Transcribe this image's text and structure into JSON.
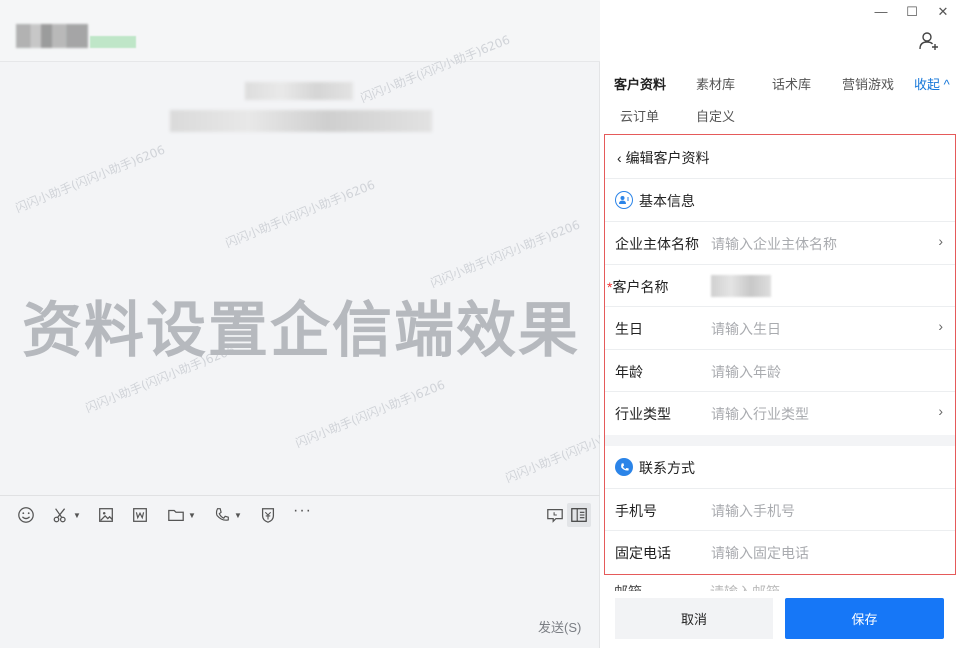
{
  "watermark_text": "闪闪小助手(闪闪小助手)6206",
  "overlay_title": "资料设置企信端效果",
  "composer": {
    "send_label": "发送(S)"
  },
  "window": {
    "minimize": "—",
    "maximize": "☐",
    "close": "✕"
  },
  "tabs": [
    {
      "label": "客户资料",
      "active": true
    },
    {
      "label": "素材库"
    },
    {
      "label": "话术库"
    },
    {
      "label": "营销游戏"
    },
    {
      "label": "云订单"
    },
    {
      "label": "自定义"
    }
  ],
  "collapse_label": "收起 ^",
  "panel": {
    "back_title": "编辑客户资料",
    "basic_section": "基本信息",
    "contact_section": "联系方式",
    "fields": [
      {
        "label": "企业主体名称",
        "placeholder": "请输入企业主体名称",
        "has_arrow": true
      },
      {
        "label": "客户名称",
        "required": true,
        "required_mark": "*"
      },
      {
        "label": "生日",
        "placeholder": "请输入生日",
        "has_arrow": true
      },
      {
        "label": "年龄",
        "placeholder": "请输入年龄"
      },
      {
        "label": "行业类型",
        "placeholder": "请输入行业类型",
        "has_arrow": true
      }
    ],
    "contact_fields": [
      {
        "label": "手机号",
        "placeholder": "请输入手机号"
      },
      {
        "label": "固定电话",
        "placeholder": "请输入固定电话"
      }
    ],
    "partially_visible": {
      "label": "邮箱",
      "placeholder": "请输入邮箱"
    }
  },
  "buttons": {
    "cancel": "取消",
    "save": "保存"
  },
  "colors": {
    "accent": "#1677f7",
    "highlight_border": "#e55a5a"
  }
}
